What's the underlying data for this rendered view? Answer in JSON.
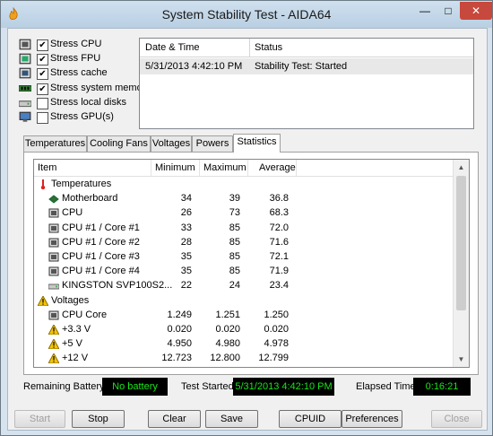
{
  "window": {
    "title": "System Stability Test - AIDA64",
    "minimize_glyph": "—",
    "maximize_glyph": "□",
    "close_glyph": "✕"
  },
  "stress_options": [
    {
      "label": "Stress CPU",
      "checked": true,
      "icon": "cpu-icon"
    },
    {
      "label": "Stress FPU",
      "checked": true,
      "icon": "fpu-icon"
    },
    {
      "label": "Stress cache",
      "checked": true,
      "icon": "cache-icon"
    },
    {
      "label": "Stress system memory",
      "checked": true,
      "icon": "memory-icon"
    },
    {
      "label": "Stress local disks",
      "checked": false,
      "icon": "disk-icon"
    },
    {
      "label": "Stress GPU(s)",
      "checked": false,
      "icon": "monitor-icon"
    }
  ],
  "log": {
    "columns": [
      "Date & Time",
      "Status"
    ],
    "rows": [
      {
        "datetime": "5/31/2013 4:42:10 PM",
        "status": "Stability Test: Started"
      }
    ]
  },
  "tabs": [
    {
      "label": "Temperatures",
      "active": false
    },
    {
      "label": "Cooling Fans",
      "active": false
    },
    {
      "label": "Voltages",
      "active": false
    },
    {
      "label": "Powers",
      "active": false
    },
    {
      "label": "Statistics",
      "active": true
    }
  ],
  "statistics": {
    "columns": [
      "Item",
      "Minimum",
      "Maximum",
      "Average"
    ],
    "rows": [
      {
        "type": "group",
        "name": "Temperatures",
        "icon": "thermometer-icon"
      },
      {
        "type": "item",
        "name": "Motherboard",
        "min": "34",
        "max": "39",
        "avg": "36.8",
        "icon": "motherboard-icon"
      },
      {
        "type": "item",
        "name": "CPU",
        "min": "26",
        "max": "73",
        "avg": "68.3",
        "icon": "cpu-icon"
      },
      {
        "type": "item",
        "name": "CPU #1 / Core #1",
        "min": "33",
        "max": "85",
        "avg": "72.0",
        "icon": "cpu-icon"
      },
      {
        "type": "item",
        "name": "CPU #1 / Core #2",
        "min": "28",
        "max": "85",
        "avg": "71.6",
        "icon": "cpu-icon"
      },
      {
        "type": "item",
        "name": "CPU #1 / Core #3",
        "min": "35",
        "max": "85",
        "avg": "72.1",
        "icon": "cpu-icon"
      },
      {
        "type": "item",
        "name": "CPU #1 / Core #4",
        "min": "35",
        "max": "85",
        "avg": "71.9",
        "icon": "cpu-icon"
      },
      {
        "type": "item",
        "name": "KINGSTON SVP100S2...",
        "min": "22",
        "max": "24",
        "avg": "23.4",
        "icon": "disk-icon"
      },
      {
        "type": "group",
        "name": "Voltages",
        "icon": "warning-icon"
      },
      {
        "type": "item",
        "name": "CPU Core",
        "min": "1.249",
        "max": "1.251",
        "avg": "1.250",
        "icon": "cpu-icon"
      },
      {
        "type": "item",
        "name": "+3.3 V",
        "min": "0.020",
        "max": "0.020",
        "avg": "0.020",
        "icon": "warning-icon"
      },
      {
        "type": "item",
        "name": "+5 V",
        "min": "4.950",
        "max": "4.980",
        "avg": "4.978",
        "icon": "warning-icon"
      },
      {
        "type": "item",
        "name": "+12 V",
        "min": "12.723",
        "max": "12.800",
        "avg": "12.799",
        "icon": "warning-icon"
      }
    ]
  },
  "status_bar": {
    "battery_label": "Remaining Battery:",
    "battery_value": "No battery",
    "started_label": "Test Started:",
    "started_value": "5/31/2013 4:42:10 PM",
    "elapsed_label": "Elapsed Time:",
    "elapsed_value": "0:16:21"
  },
  "buttons": [
    {
      "label": "Start",
      "enabled": false
    },
    {
      "label": "Stop",
      "enabled": true
    },
    {
      "label": "Clear",
      "enabled": true
    },
    {
      "label": "Save",
      "enabled": true
    },
    {
      "label": "CPUID",
      "enabled": true
    },
    {
      "label": "Preferences",
      "enabled": true
    },
    {
      "label": "Close",
      "enabled": false
    }
  ],
  "colors": {
    "status_text": "#19e619",
    "status_bg": "#000000",
    "close_button": "#c7483c"
  }
}
